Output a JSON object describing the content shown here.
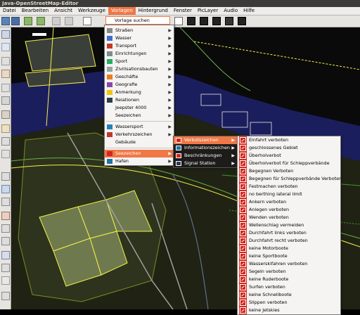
{
  "window": {
    "title": "Java-OpenStreetMap-Editor"
  },
  "menubar": {
    "items": [
      "Datei",
      "Bearbeiten",
      "Ansicht",
      "Werkzeuge",
      "Vorlagen",
      "Hintergrund",
      "Fenster",
      "PicLayer",
      "Audio",
      "Hilfe"
    ],
    "active_index": 4
  },
  "toolbar": {
    "buttons": [
      {
        "name": "open-icon"
      },
      {
        "name": "save-icon"
      },
      {
        "name": "upload-icon"
      },
      {
        "name": "download-icon"
      },
      {
        "name": "undo-icon"
      },
      {
        "name": "redo-icon"
      },
      {
        "name": "zoom-icon"
      }
    ],
    "right_buttons": [
      {
        "name": "hand-icon"
      },
      {
        "name": "car-icon"
      },
      {
        "name": "bus-icon"
      },
      {
        "name": "person-icon"
      },
      {
        "name": "image-icon"
      },
      {
        "name": "factory-icon"
      }
    ]
  },
  "presets_menu": {
    "search_label": "Vorlage suchen",
    "items": [
      {
        "label": "Straßen",
        "icon": "road-icon",
        "submenu": true
      },
      {
        "label": "Wasser",
        "icon": "water-icon",
        "submenu": true
      },
      {
        "label": "Transport",
        "icon": "transport-icon",
        "submenu": true
      },
      {
        "label": "Einrichtungen",
        "icon": "facilities-icon",
        "submenu": true
      },
      {
        "label": "Sport",
        "icon": "sport-icon",
        "submenu": true
      },
      {
        "label": "Zivilisationsbauten",
        "icon": "buildings-icon",
        "submenu": true
      },
      {
        "label": "Geschäfte",
        "icon": "shop-icon",
        "submenu": true
      },
      {
        "label": "Geografie",
        "icon": "geography-icon",
        "submenu": true
      },
      {
        "label": "Anmerkung",
        "icon": "annotation-icon",
        "submenu": true
      },
      {
        "label": "Relationen",
        "icon": "relations-icon",
        "submenu": true
      },
      {
        "label": "Jeepster 4000",
        "icon": "",
        "submenu": true
      },
      {
        "label": "Seezeichen",
        "icon": "",
        "submenu": true
      },
      {
        "label": "Wassersport",
        "icon": "watersport-icon",
        "submenu": true
      },
      {
        "label": "Verkehrszeichen",
        "icon": "traffic-sign-icon",
        "submenu": true
      },
      {
        "label": "Gebäude",
        "icon": "",
        "submenu": false
      },
      {
        "label": "Seezeichen",
        "icon": "seamark-icon",
        "submenu": true,
        "highlighted": true
      },
      {
        "label": "Hafen",
        "icon": "harbour-icon",
        "submenu": true
      }
    ]
  },
  "seamark_menu": {
    "items": [
      {
        "label": "Verbotszeichen",
        "highlighted": true
      },
      {
        "label": "Informationszeichen"
      },
      {
        "label": "Beschränkungen"
      },
      {
        "label": "Signal Station"
      }
    ]
  },
  "prohibition_menu": {
    "items": [
      "Einfahrt verboten",
      "geschlossenes Gebiet",
      "Überholverbot",
      "Überholverbot für Schleppverbände",
      "Begegnen Verboten",
      "Begegnen für Schleppverbände Verboten",
      "Festmachen verboten",
      "no berthing lateral limit",
      "Ankern verboten",
      "Anlegen verboten",
      "Wenden verboten",
      "Wellenschlag vermeiden",
      "Durchfahrt links verboten",
      "Durchfahrt recht verboten",
      "keine Motorboote",
      "keine Sportboote",
      "Wasserskifahren verboten",
      "Segeln verboten",
      "keine Ruderboote",
      "Surfen verboten",
      "keine Schnellboote",
      "Slippen verboten",
      "keine Jetskies"
    ]
  },
  "colors": {
    "accent": "#f07746",
    "sign_red": "#d3261e",
    "map_background": "#000000",
    "building_fill": "#6e7a4e",
    "water": "#1b1e5c",
    "way_yellow": "#f6f04a",
    "way_green": "#3b9a2c"
  }
}
